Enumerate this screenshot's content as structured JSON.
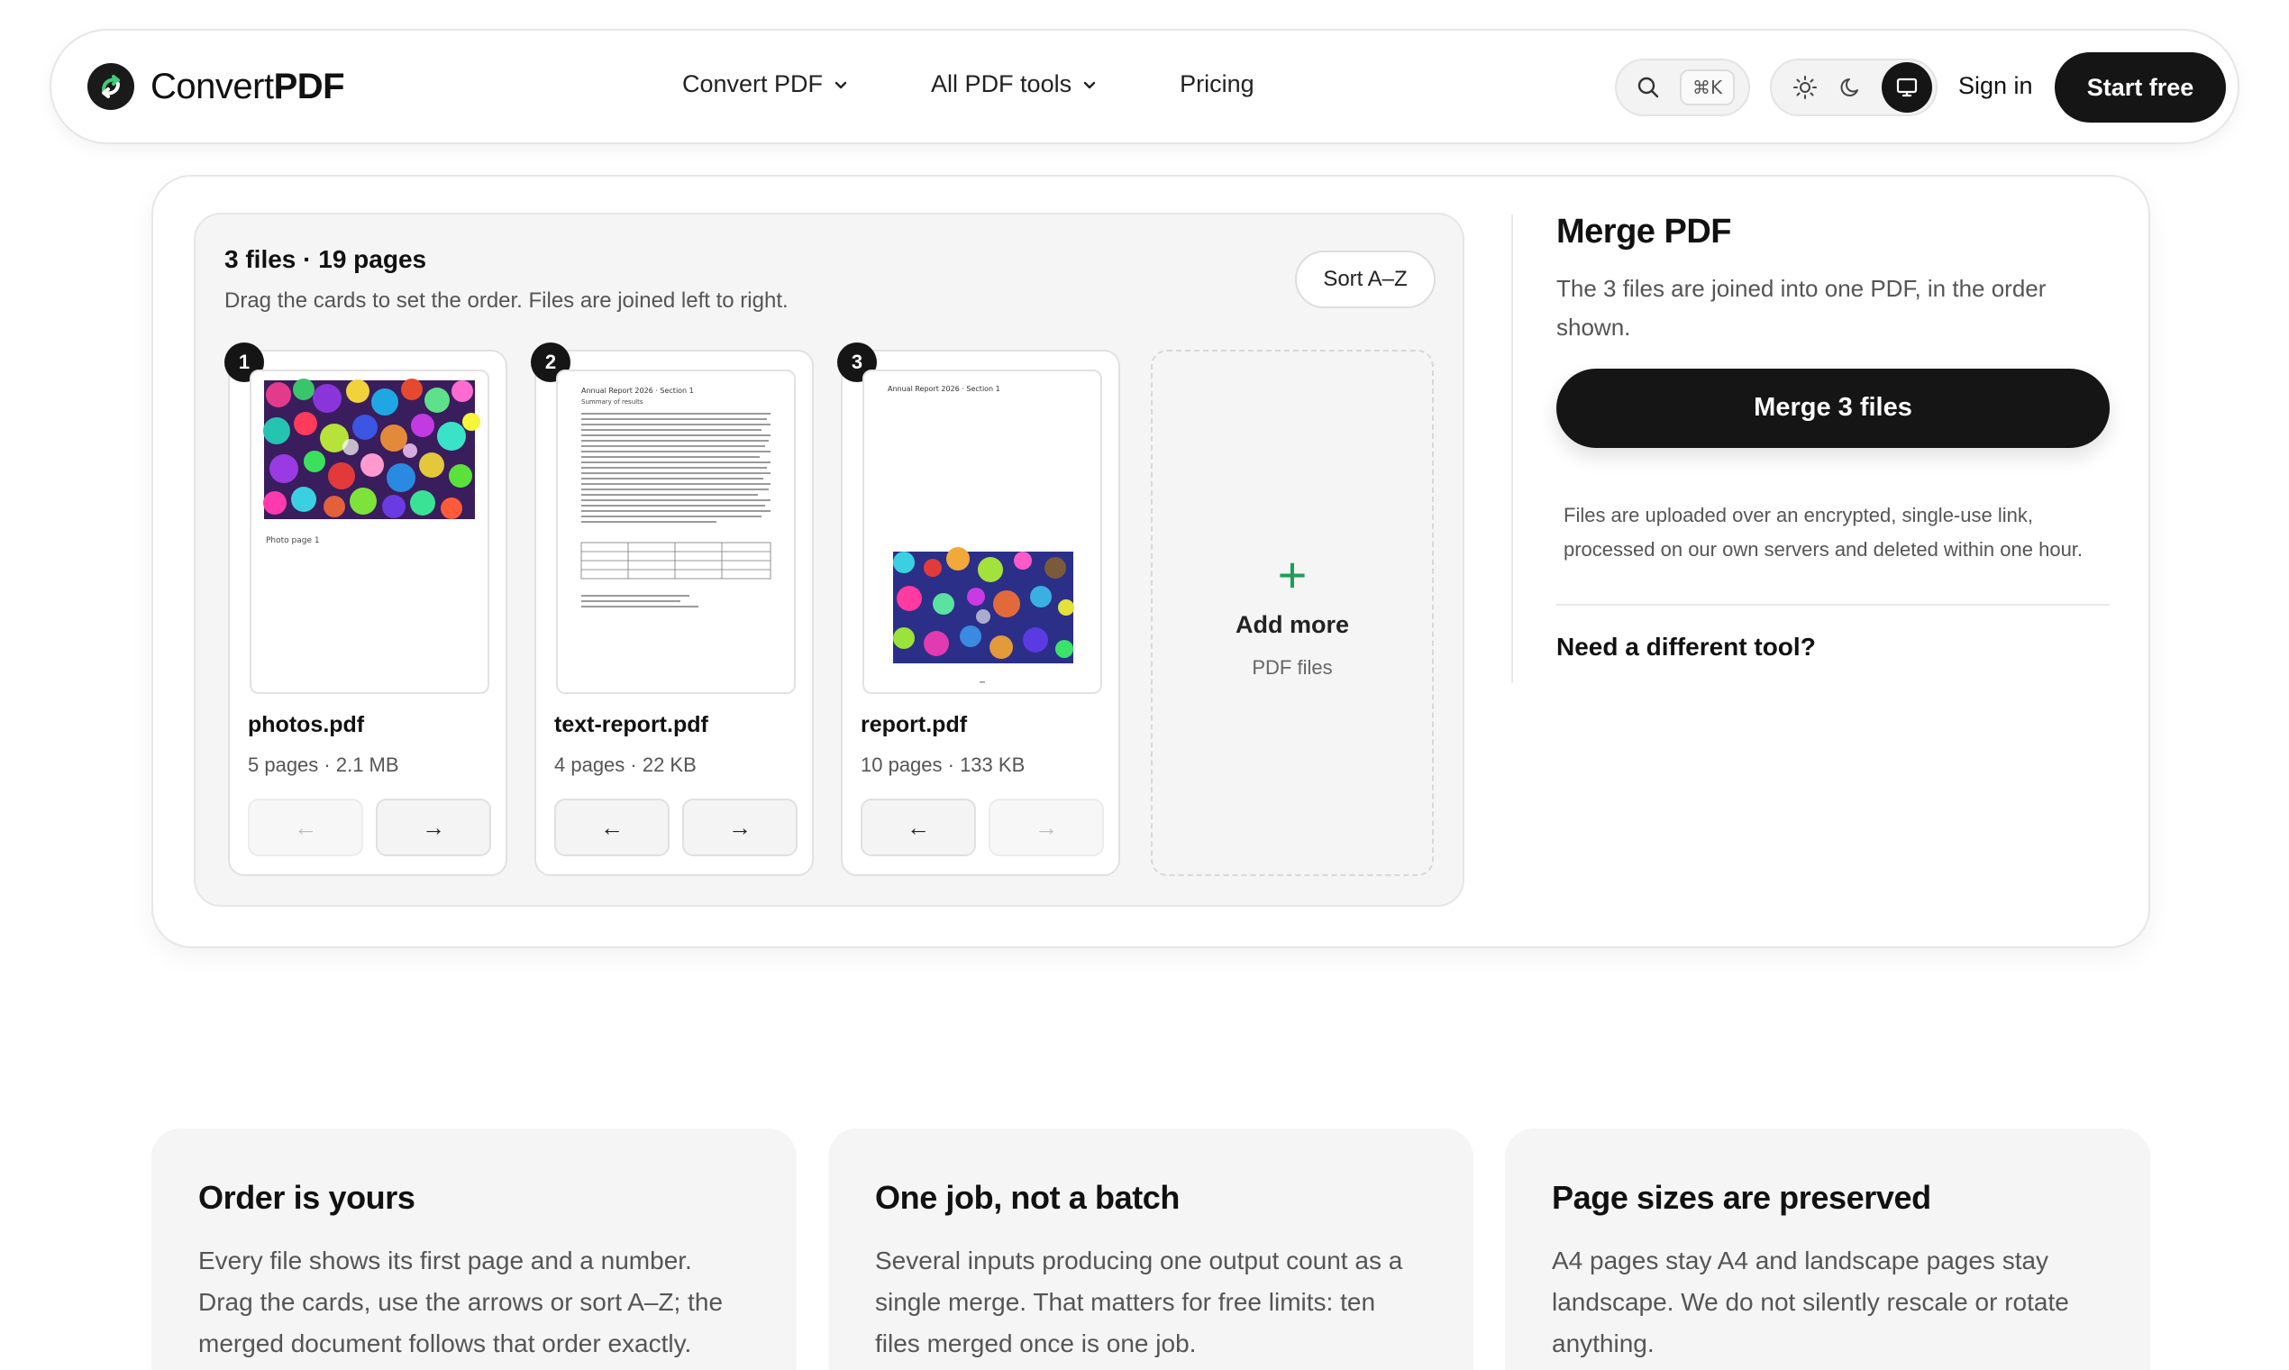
{
  "nav": {
    "brand_light": "Convert",
    "brand_bold": "PDF",
    "links": [
      {
        "label": "Convert PDF",
        "has_menu": true
      },
      {
        "label": "All PDF tools",
        "has_menu": true
      },
      {
        "label": "Pricing",
        "has_menu": false
      }
    ],
    "search_shortcut": "⌘K",
    "theme_options": [
      "light",
      "dark",
      "system"
    ],
    "theme_selected": "system",
    "sign_in": "Sign in",
    "start_free": "Start free"
  },
  "files": {
    "summary": "3 files · 19 pages",
    "hint": "Drag the cards to set the order. Files are joined left to right.",
    "sort_label": "Sort A–Z",
    "items": [
      {
        "index": "1",
        "name": "photos.pdf",
        "meta": "5 pages · 2.1 MB",
        "preview": "photo",
        "preview_caption": "Photo page 1",
        "left_disabled": true,
        "right_disabled": false
      },
      {
        "index": "2",
        "name": "text-report.pdf",
        "meta": "4 pages · 22 KB",
        "preview": "text",
        "preview_heading": "Annual Report 2026 · Section 1",
        "preview_subheading": "Summary of results",
        "left_disabled": false,
        "right_disabled": false
      },
      {
        "index": "3",
        "name": "report.pdf",
        "meta": "10 pages · 133 KB",
        "preview": "mixed",
        "preview_heading": "Annual Report 2026 · Section 1",
        "left_disabled": false,
        "right_disabled": true
      }
    ],
    "arrow_left": "←",
    "arrow_right": "→",
    "add_more": {
      "plus": "+",
      "title": "Add more",
      "subtitle": "PDF files"
    }
  },
  "merge": {
    "title": "Merge PDF",
    "description": "The 3 files are joined into one PDF, in the order shown.",
    "button": "Merge 3 files",
    "note": "Files are uploaded over an encrypted, single-use link, processed on our own servers and deleted within one hour.",
    "more_tools": "Need a different tool?"
  },
  "features": [
    {
      "title": "Order is yours",
      "body": "Every file shows its first page and a number. Drag the cards, use the arrows or sort A–Z; the merged document follows that order exactly."
    },
    {
      "title": "One job, not a batch",
      "body": "Several inputs producing one output count as a single merge. That matters for free limits: ten files merged once is one job."
    },
    {
      "title": "Page sizes are preserved",
      "body": "A4 pages stay A4 and landscape pages stay landscape. We do not silently rescale or rotate anything."
    }
  ],
  "colors": {
    "accent_dark": "#151515",
    "plus_green": "#1f9d5b",
    "panel_gray": "#f5f5f5"
  }
}
